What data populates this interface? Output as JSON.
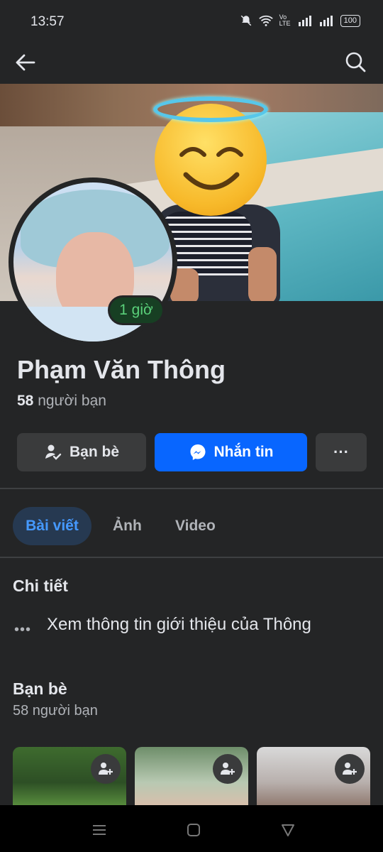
{
  "status": {
    "time": "13:57",
    "network": "Vo LTE",
    "battery": "100"
  },
  "topbar": {
    "back_icon": "arrow-left-icon",
    "search_icon": "search-icon"
  },
  "profile": {
    "active_badge": "1 giờ",
    "name": "Phạm Văn Thông",
    "friend_count": "58",
    "friend_label": "người bạn"
  },
  "actions": {
    "friends_label": "Bạn bè",
    "message_label": "Nhắn tin",
    "more_label": "···"
  },
  "tabs": [
    {
      "label": "Bài viết",
      "active": true
    },
    {
      "label": "Ảnh",
      "active": false
    },
    {
      "label": "Video",
      "active": false
    }
  ],
  "details": {
    "title": "Chi tiết",
    "dots": "•••",
    "link_text": "Xem thông tin giới thiệu của Thông"
  },
  "friends": {
    "title": "Bạn bè",
    "subtitle": "58 người bạn"
  },
  "colors": {
    "accent": "#0866ff",
    "background": "#242526",
    "badge_text": "#5ad07a"
  }
}
